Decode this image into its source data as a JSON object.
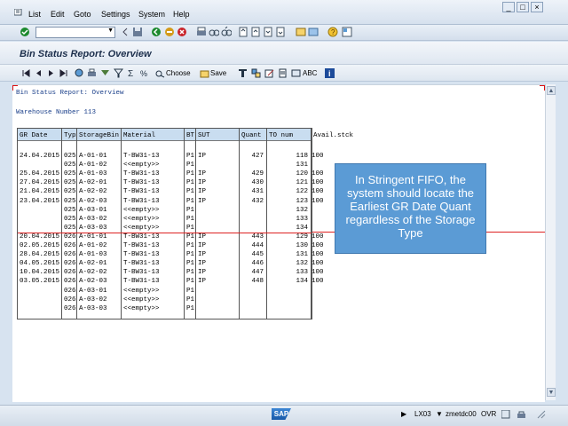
{
  "menu": {
    "items": [
      "List",
      "Edit",
      "Goto",
      "Settings",
      "System",
      "Help"
    ]
  },
  "toolbar": {
    "command_field": ""
  },
  "titlebar": {
    "title": "Bin Status Report: Overview"
  },
  "app_toolbar": {
    "choose_label": "Choose",
    "save_label": "Save",
    "abc_label": "ABC"
  },
  "report": {
    "heading": "Bin Status Report: Overview",
    "warehouse_label": "Warehouse Number 113",
    "columns": [
      "GR Date",
      "Typ",
      "StorageBin",
      "Material",
      "BT",
      "SUT",
      "Quant",
      "TO num",
      "Avail.stck"
    ],
    "rows": [
      [
        "24.04.2015",
        "025",
        "A-01-01",
        "T-BW31-13",
        "P1",
        "IP",
        "427",
        "118",
        "100"
      ],
      [
        "",
        "025",
        "A-01-02",
        "<<empty>>",
        "P1",
        "",
        "",
        "131",
        ""
      ],
      [
        "25.04.2015",
        "025",
        "A-01-03",
        "T-BW31-13",
        "P1",
        "IP",
        "429",
        "120",
        "100"
      ],
      [
        "27.04.2015",
        "025",
        "A-02-01",
        "T-BW31-13",
        "P1",
        "IP",
        "430",
        "121",
        "100"
      ],
      [
        "21.04.2015",
        "025",
        "A-02-02",
        "T-BW31-13",
        "P1",
        "IP",
        "431",
        "122",
        "100"
      ],
      [
        "23.04.2015",
        "025",
        "A-02-03",
        "T-BW31-13",
        "P1",
        "IP",
        "432",
        "123",
        "100"
      ],
      [
        "",
        "025",
        "A-03-01",
        "<<empty>>",
        "P1",
        "",
        "",
        "132",
        ""
      ],
      [
        "",
        "025",
        "A-03-02",
        "<<empty>>",
        "P1",
        "",
        "",
        "133",
        ""
      ],
      [
        "",
        "025",
        "A-03-03",
        "<<empty>>",
        "P1",
        "",
        "",
        "134",
        ""
      ],
      [
        "20.04.2015",
        "026",
        "A-01-01",
        "T-BW31-13",
        "P1",
        "IP",
        "443",
        "129",
        "100"
      ],
      [
        "02.05.2015",
        "026",
        "A-01-02",
        "T-BW31-13",
        "P1",
        "IP",
        "444",
        "130",
        "100"
      ],
      [
        "28.04.2015",
        "026",
        "A-01-03",
        "T-BW31-13",
        "P1",
        "IP",
        "445",
        "131",
        "100"
      ],
      [
        "04.05.2015",
        "026",
        "A-02-01",
        "T-BW31-13",
        "P1",
        "IP",
        "446",
        "132",
        "100"
      ],
      [
        "10.04.2015",
        "026",
        "A-02-02",
        "T-BW31-13",
        "P1",
        "IP",
        "447",
        "133",
        "100"
      ],
      [
        "03.05.2015",
        "026",
        "A-02-03",
        "T-BW31-13",
        "P1",
        "IP",
        "448",
        "134",
        "100"
      ],
      [
        "",
        "026",
        "A-03-01",
        "<<empty>>",
        "P1",
        "",
        "",
        "",
        ""
      ],
      [
        "",
        "026",
        "A-03-02",
        "<<empty>>",
        "P1",
        "",
        "",
        "",
        ""
      ],
      [
        "",
        "026",
        "A-03-03",
        "<<empty>>",
        "P1",
        "",
        "",
        "",
        ""
      ]
    ]
  },
  "callout": {
    "text": "In Stringent FIFO, the system should locate the Earliest GR Date Quant regardless of the Storage Type"
  },
  "statusbar": {
    "transaction": "LX03",
    "server": "zmetdc00",
    "mode": "OVR"
  },
  "colors": {
    "accent": "#5b9bd5",
    "header_bg": "#c9ddf0",
    "divider": "#d22222"
  }
}
